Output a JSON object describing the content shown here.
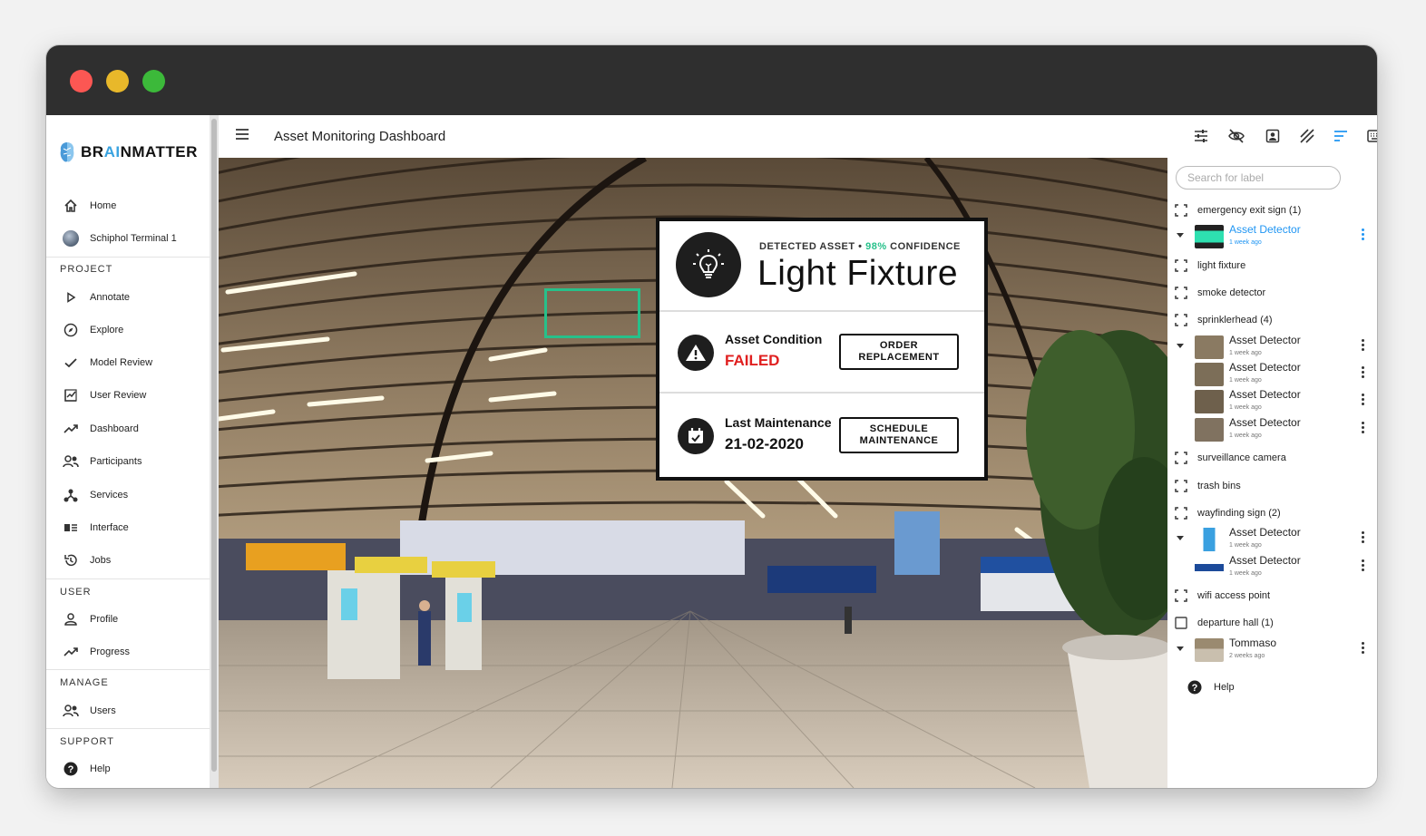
{
  "app": {
    "logo": "BRAINMATTER",
    "page_title": "Asset Monitoring Dashboard"
  },
  "sidebar": {
    "top_items": [
      {
        "label": "Home",
        "icon": "home-icon"
      },
      {
        "label": "Schiphol Terminal 1",
        "icon": "project-avatar"
      }
    ],
    "sections": [
      {
        "title": "PROJECT",
        "items": [
          {
            "label": "Annotate",
            "icon": "play-icon"
          },
          {
            "label": "Explore",
            "icon": "compass-icon"
          },
          {
            "label": "Model Review",
            "icon": "check-icon"
          },
          {
            "label": "User Review",
            "icon": "chart-box-icon"
          },
          {
            "label": "Dashboard",
            "icon": "trend-icon"
          },
          {
            "label": "Participants",
            "icon": "people-icon"
          },
          {
            "label": "Services",
            "icon": "network-icon"
          },
          {
            "label": "Interface",
            "icon": "interface-icon"
          },
          {
            "label": "Jobs",
            "icon": "history-icon"
          }
        ]
      },
      {
        "title": "USER",
        "items": [
          {
            "label": "Profile",
            "icon": "person-icon"
          },
          {
            "label": "Progress",
            "icon": "trend-icon"
          }
        ]
      },
      {
        "title": "MANAGE",
        "items": [
          {
            "label": "Users",
            "icon": "people-icon"
          }
        ]
      },
      {
        "title": "SUPPORT",
        "items": [
          {
            "label": "Help",
            "icon": "help-icon"
          }
        ]
      }
    ]
  },
  "toolbar": {
    "icons": [
      "sliders-icon",
      "eye-off-icon",
      "portrait-icon",
      "hatch-icon",
      "sort-icon",
      "keyboard-icon",
      "close-icon"
    ]
  },
  "card": {
    "detected_prefix": "DETECTED ASSET • ",
    "confidence": "98%",
    "confidence_suffix": " CONFIDENCE",
    "asset_name": "Light Fixture",
    "condition_label": "Asset Condition",
    "condition_value": "FAILED",
    "order_button": "ORDER REPLACEMENT",
    "maintenance_label": "Last Maintenance",
    "maintenance_value": "21-02-2020",
    "schedule_button": "SCHEDULE MAINTENANCE"
  },
  "panel": {
    "search_placeholder": "Search for label",
    "labels": [
      {
        "text": "emergency exit sign (1)"
      },
      {
        "text": "light fixture"
      },
      {
        "text": "smoke detector"
      },
      {
        "text": "sprinklerhead (4)"
      },
      {
        "text": "surveillance camera"
      },
      {
        "text": "trash bins"
      },
      {
        "text": "wayfinding sign (2)"
      },
      {
        "text": "wifi access point"
      },
      {
        "text": "departure hall (1)"
      }
    ],
    "detections": {
      "emergency": [
        {
          "name": "Asset Detector",
          "time": "1 week ago"
        }
      ],
      "sprinkler": [
        {
          "name": "Asset Detector",
          "time": "1 week ago"
        },
        {
          "name": "Asset Detector",
          "time": "1 week ago"
        },
        {
          "name": "Asset Detector",
          "time": "1 week ago"
        },
        {
          "name": "Asset Detector",
          "time": "1 week ago"
        }
      ],
      "wayfinding": [
        {
          "name": "Asset Detector",
          "time": "1 week ago"
        },
        {
          "name": "Asset Detector",
          "time": "1 week ago"
        }
      ],
      "departure": [
        {
          "name": "Tommaso",
          "time": "2 weeks ago"
        }
      ]
    },
    "help": "Help"
  },
  "colors": {
    "accent_green": "#27c08a",
    "failed_red": "#e02020",
    "link_blue": "#2196f3"
  }
}
